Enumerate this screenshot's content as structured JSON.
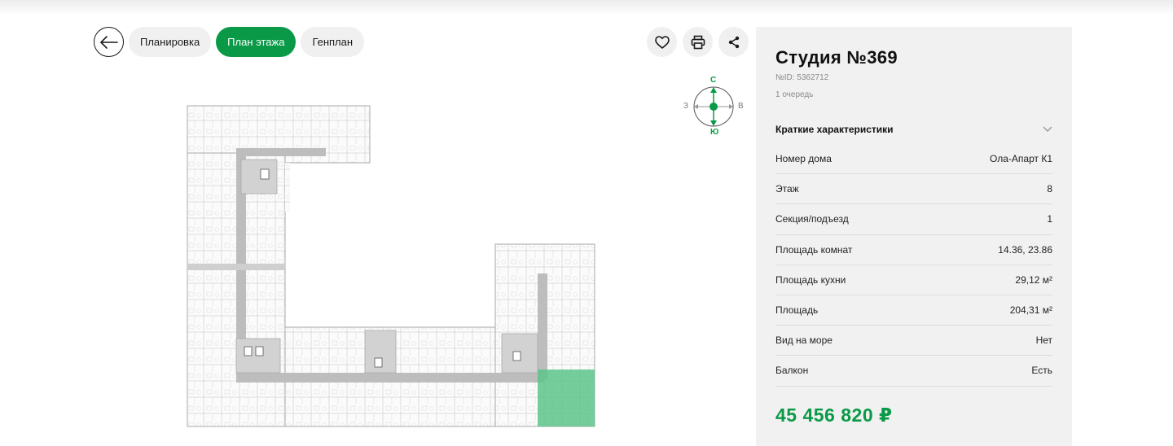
{
  "nav": {
    "tabs": [
      {
        "label": "Планировка",
        "active": false
      },
      {
        "label": "План этажа",
        "active": true
      },
      {
        "label": "Генплан",
        "active": false
      }
    ]
  },
  "compass": {
    "north": "С",
    "south": "Ю",
    "west": "З",
    "east": "В"
  },
  "colors": {
    "accent": "#0a9a47",
    "highlight": "#5cc48a"
  },
  "unit": {
    "title": "Студия №369",
    "id_label": "№ID: 5362712",
    "queue": "1 очередь",
    "section_title": "Краткие характеристики",
    "specs": [
      {
        "label": "Номер дома",
        "value": "Ола-Апарт К1"
      },
      {
        "label": "Этаж",
        "value": "8"
      },
      {
        "label": "Секция/подъезд",
        "value": "1"
      },
      {
        "label": "Площадь комнат",
        "value": "14.36, 23.86"
      },
      {
        "label": "Площадь кухни",
        "value": "29,12 м²"
      },
      {
        "label": "Площадь",
        "value": "204,31 м²"
      },
      {
        "label": "Вид на море",
        "value": "Нет"
      },
      {
        "label": "Балкон",
        "value": "Есть"
      }
    ],
    "price": "45 456 820 ₽"
  }
}
